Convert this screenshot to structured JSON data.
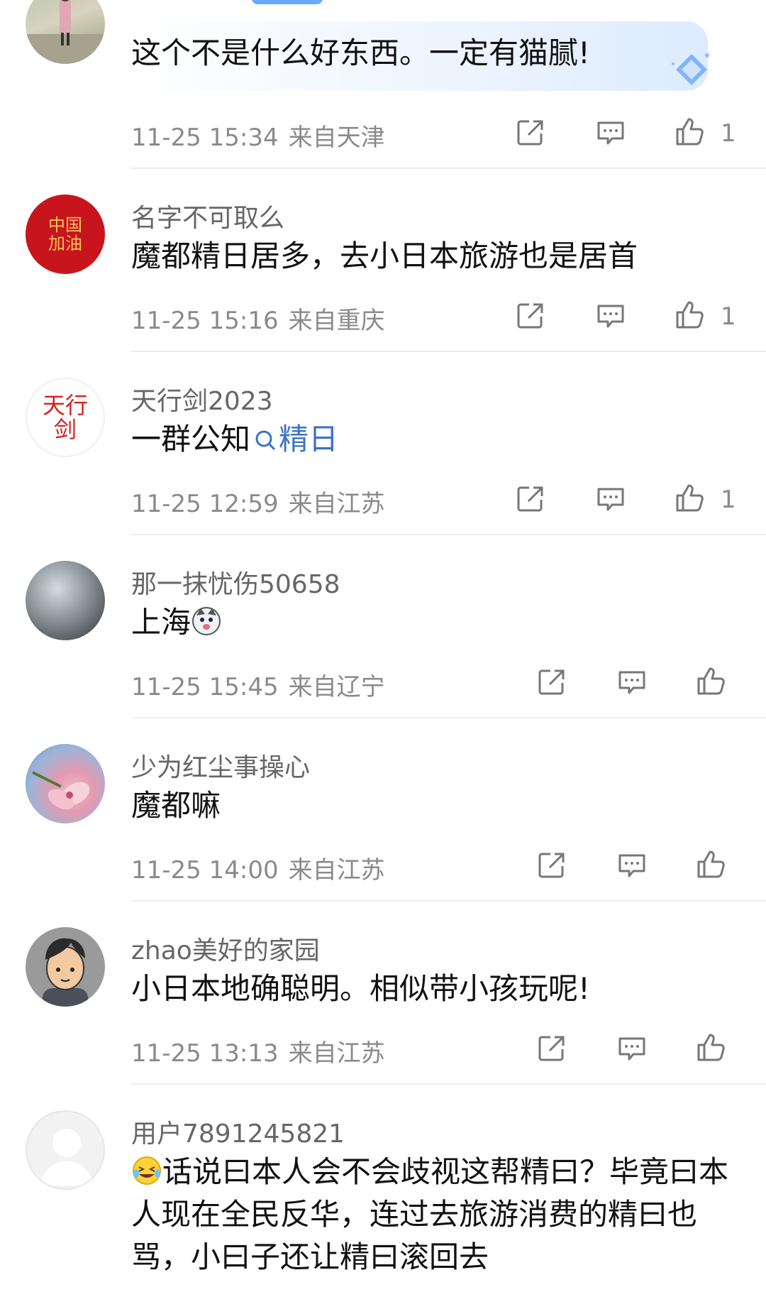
{
  "comments": [
    {
      "username": "",
      "text": "这个不是什么好东西。一定有猫腻!",
      "time": "11-25 15:34",
      "location": "来自天津",
      "likes": "1"
    },
    {
      "username": "名字不可取么",
      "text": "魔都精日居多，去小日本旅游也是居首",
      "time": "11-25 15:16",
      "location": "来自重庆",
      "likes": "1",
      "avatar_text": "中国加油"
    },
    {
      "username": "天行剑2023",
      "text_prefix": "一群公知",
      "text_link": "精日",
      "time": "11-25 12:59",
      "location": "来自江苏",
      "likes": "1",
      "avatar_text": "天行剑"
    },
    {
      "username": "那一抹忧伤50658",
      "text": "上海",
      "time": "11-25 15:45",
      "location": "来自辽宁",
      "likes": ""
    },
    {
      "username": "少为红尘事操心",
      "text": "魔都嘛",
      "time": "11-25 14:00",
      "location": "来自江苏",
      "likes": ""
    },
    {
      "username": "zhao美好的家园",
      "text": "小日本地确聪明。相似带小孩玩呢!",
      "time": "11-25 13:13",
      "location": "来自江苏",
      "likes": ""
    },
    {
      "username": "用户7891245821",
      "text": "话说曰本人会不会歧视这帮精曰？毕竟曰本人现在全民反华，连过去旅游消费的精曰也骂，小曰子还让精曰滚回去"
    }
  ],
  "icons": {
    "share": "share-icon",
    "reply": "comment-icon",
    "like": "thumbs-up-icon",
    "search": "search-icon"
  },
  "colors": {
    "link": "#3a73c9",
    "meta": "#8a8a8a",
    "divider": "#ececec"
  }
}
